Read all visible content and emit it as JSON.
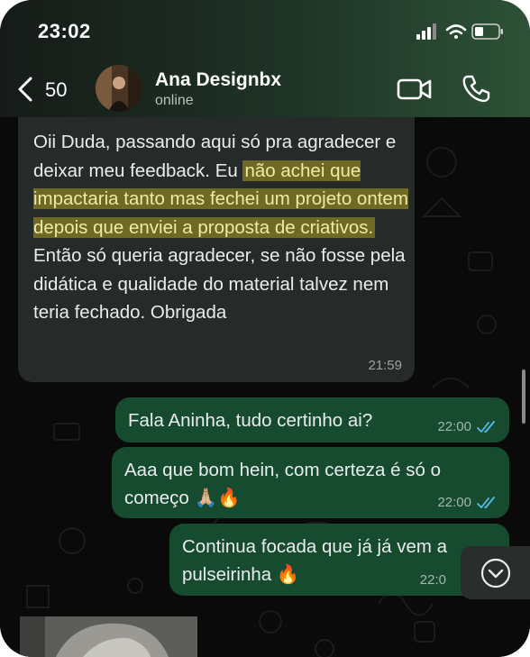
{
  "status_bar": {
    "time": "23:02"
  },
  "header": {
    "back_count": "50",
    "contact_name": "Ana Designbx",
    "contact_status": "online"
  },
  "messages": [
    {
      "direction": "incoming",
      "text_parts": [
        "Oii Duda, passando aqui só pra agradecer e deixar meu feedback. Eu ",
        "não achei que impactaria tanto mas fechei um projeto ontem depois que enviei a proposta de criativos.",
        " Então só queria agradecer, se não fosse pela didática e qualidade do material talvez nem teria fechado. Obrigada"
      ],
      "time": "21:59"
    },
    {
      "direction": "outgoing",
      "text": "Fala Aninha, tudo certinho ai?",
      "time": "22:00",
      "status": "read"
    },
    {
      "direction": "outgoing",
      "text": "Aaa que bom hein, com certeza é só o começo 🙏🏼🔥",
      "time": "22:00",
      "status": "read"
    },
    {
      "direction": "outgoing",
      "text": "Continua focada que já já vem a pulseirinha 🔥",
      "time": "22:0",
      "status": "read"
    }
  ],
  "icons": [
    "back-chevron-icon",
    "video-camera-icon",
    "phone-icon",
    "chevron-down-icon",
    "signal-icon",
    "wifi-icon",
    "battery-icon",
    "double-check-icon"
  ],
  "colors": {
    "incoming_bubble": "#262a28",
    "outgoing_bubble": "#174b30",
    "highlight": "#6e6a23",
    "read_ticks": "#53bdeb",
    "header_accent": "#2d5237"
  }
}
